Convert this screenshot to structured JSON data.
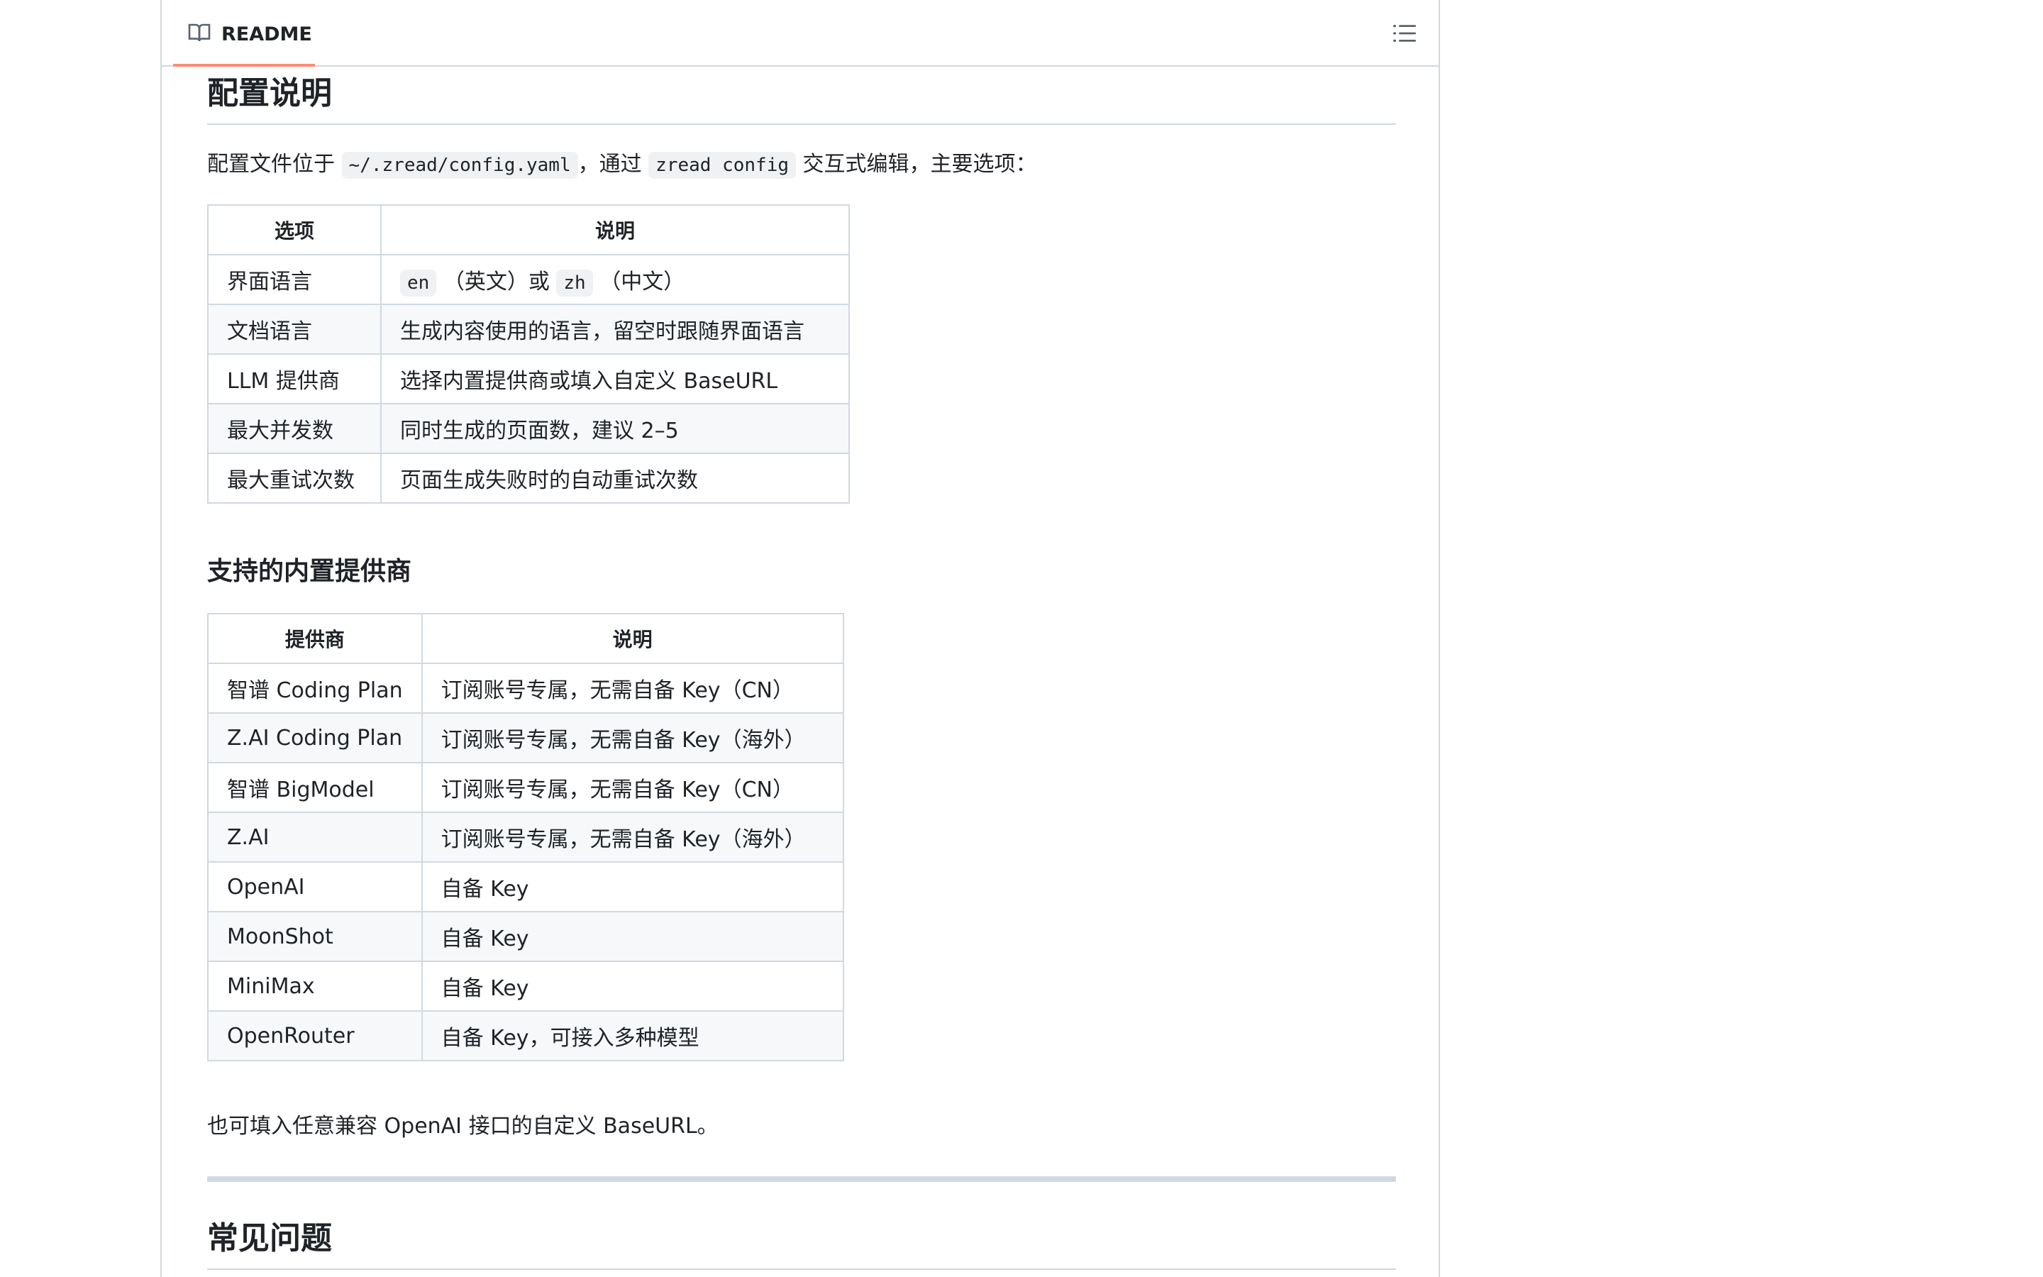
{
  "header": {
    "readme_label": "README",
    "book_icon": "book-icon",
    "toc_icon": "list-unordered-icon"
  },
  "section_config": {
    "title": "配置说明",
    "intro_before": "配置文件位于 ",
    "intro_code1": "~/.zread/config.yaml",
    "intro_mid": "，通过 ",
    "intro_code2": "zread config",
    "intro_after": " 交互式编辑，主要选项：",
    "table": {
      "headers": [
        "选项",
        "说明"
      ],
      "rows": [
        {
          "option": "界面语言",
          "code1": "en",
          "text1": " （英文）或 ",
          "code2": "zh",
          "text2": " （中文）"
        },
        {
          "option": "文档语言",
          "desc": "生成内容使用的语言，留空时跟随界面语言"
        },
        {
          "option": "LLM 提供商",
          "desc": "选择内置提供商或填入自定义 BaseURL"
        },
        {
          "option": "最大并发数",
          "desc": "同时生成的页面数，建议 2–5"
        },
        {
          "option": "最大重试次数",
          "desc": "页面生成失败时的自动重试次数"
        }
      ]
    }
  },
  "section_providers": {
    "title": "支持的内置提供商",
    "table": {
      "headers": [
        "提供商",
        "说明"
      ],
      "rows": [
        {
          "provider": "智谱 Coding Plan",
          "desc": "订阅账号专属，无需自备 Key（CN）"
        },
        {
          "provider": "Z.AI Coding Plan",
          "desc": "订阅账号专属，无需自备 Key（海外）"
        },
        {
          "provider": "智谱 BigModel",
          "desc": "订阅账号专属，无需自备 Key（CN）"
        },
        {
          "provider": "Z.AI",
          "desc": "订阅账号专属，无需自备 Key（海外）"
        },
        {
          "provider": "OpenAI",
          "desc": "自备 Key"
        },
        {
          "provider": "MoonShot",
          "desc": "自备 Key"
        },
        {
          "provider": "MiniMax",
          "desc": "自备 Key"
        },
        {
          "provider": "OpenRouter",
          "desc": "自备 Key，可接入多种模型"
        }
      ]
    },
    "footnote": "也可填入任意兼容 OpenAI 接口的自定义 BaseURL。"
  },
  "section_faq": {
    "title": "常见问题"
  }
}
